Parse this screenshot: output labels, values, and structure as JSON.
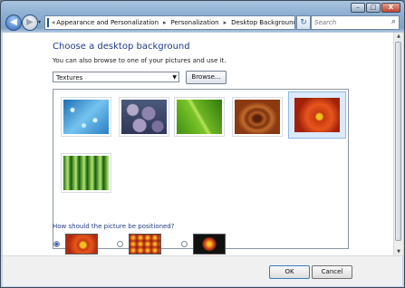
{
  "window": {
    "minimize": "–",
    "maximize": "□",
    "close": "X"
  },
  "nav": {
    "back": "◀",
    "forward": "▶",
    "recent": "▾",
    "refresh": "↻",
    "address": {
      "chevrons": "«",
      "crumbs": [
        "Appearance and Personalization",
        "Personalization",
        "Desktop Background"
      ],
      "separator": "▸",
      "dropdown": "▾"
    },
    "search": {
      "placeholder": "Search",
      "icon": "search-icon"
    }
  },
  "main": {
    "heading": "Choose a desktop background",
    "subtext": "You can also browse to one of your pictures and use it.",
    "location_select": "Textures",
    "browse_button": "Browse...",
    "gallery": [
      {
        "name": "water-drops",
        "selected": false
      },
      {
        "name": "stones",
        "selected": false
      },
      {
        "name": "leaf",
        "selected": false
      },
      {
        "name": "wood",
        "selected": false
      },
      {
        "name": "red-daisy",
        "selected": true
      },
      {
        "name": "bamboo",
        "selected": false
      }
    ],
    "position_question": "How should the picture be positioned?",
    "position_options": [
      {
        "name": "fit-to-screen",
        "checked": true
      },
      {
        "name": "tile",
        "checked": false
      },
      {
        "name": "center",
        "checked": false
      }
    ]
  },
  "footer": {
    "ok": "OK",
    "cancel": "Cancel"
  },
  "colors": {
    "heading": "#1e3c82",
    "selection": "#dbeafb"
  }
}
